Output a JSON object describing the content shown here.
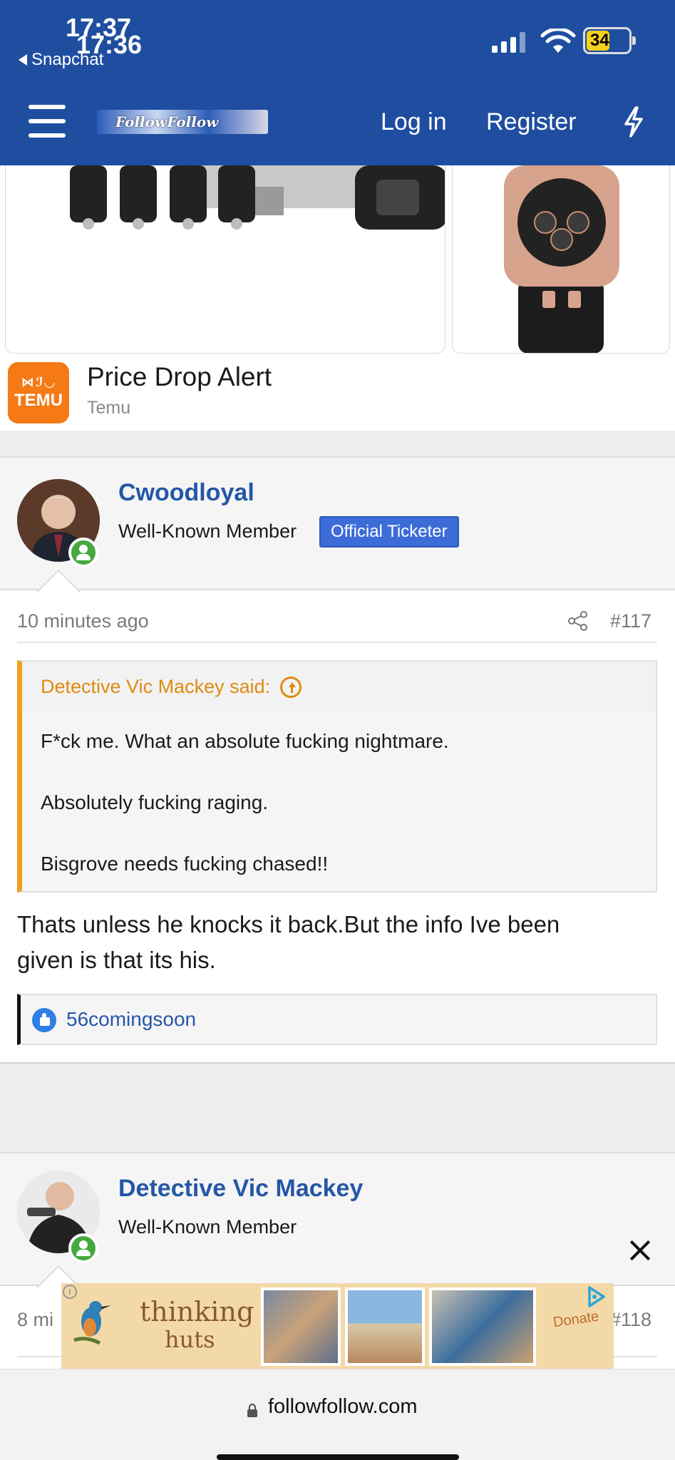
{
  "status_bar": {
    "time_primary": "17:37",
    "time_secondary": "17:36",
    "back_app": "Snapchat",
    "battery": "34"
  },
  "header": {
    "logo_text": "FollowFollow",
    "login_label": "Log in",
    "register_label": "Register"
  },
  "ad": {
    "title": "Price Drop Alert",
    "sponsor": "Temu",
    "logo_text_top": "⋈ℐ◡",
    "logo_text": "TEMU"
  },
  "posts": [
    {
      "username": "Cwoodloyal",
      "user_title": "Well-Known Member",
      "badge": "Official Ticketer",
      "time": "10 minutes ago",
      "post_number": "#117",
      "quote": {
        "author_line": "Detective Vic Mackey said:",
        "lines": [
          "F*ck me. What an absolute fucking nightmare.",
          "Absolutely fucking raging.",
          "Bisgrove needs fucking chased!!"
        ]
      },
      "body_lines": [
        "Thats unless he knocks it back.But the info Ive been",
        "given is that its his."
      ],
      "reactions": {
        "users": "56comingsoon"
      }
    },
    {
      "username": "Detective Vic Mackey",
      "user_title": "Well-Known Member",
      "time": "8 mi",
      "post_number": "#118"
    }
  ],
  "banner_ad": {
    "line1": "thinking",
    "line2": "huts",
    "cta": "Donate"
  },
  "browser": {
    "url": "followfollow.com"
  }
}
